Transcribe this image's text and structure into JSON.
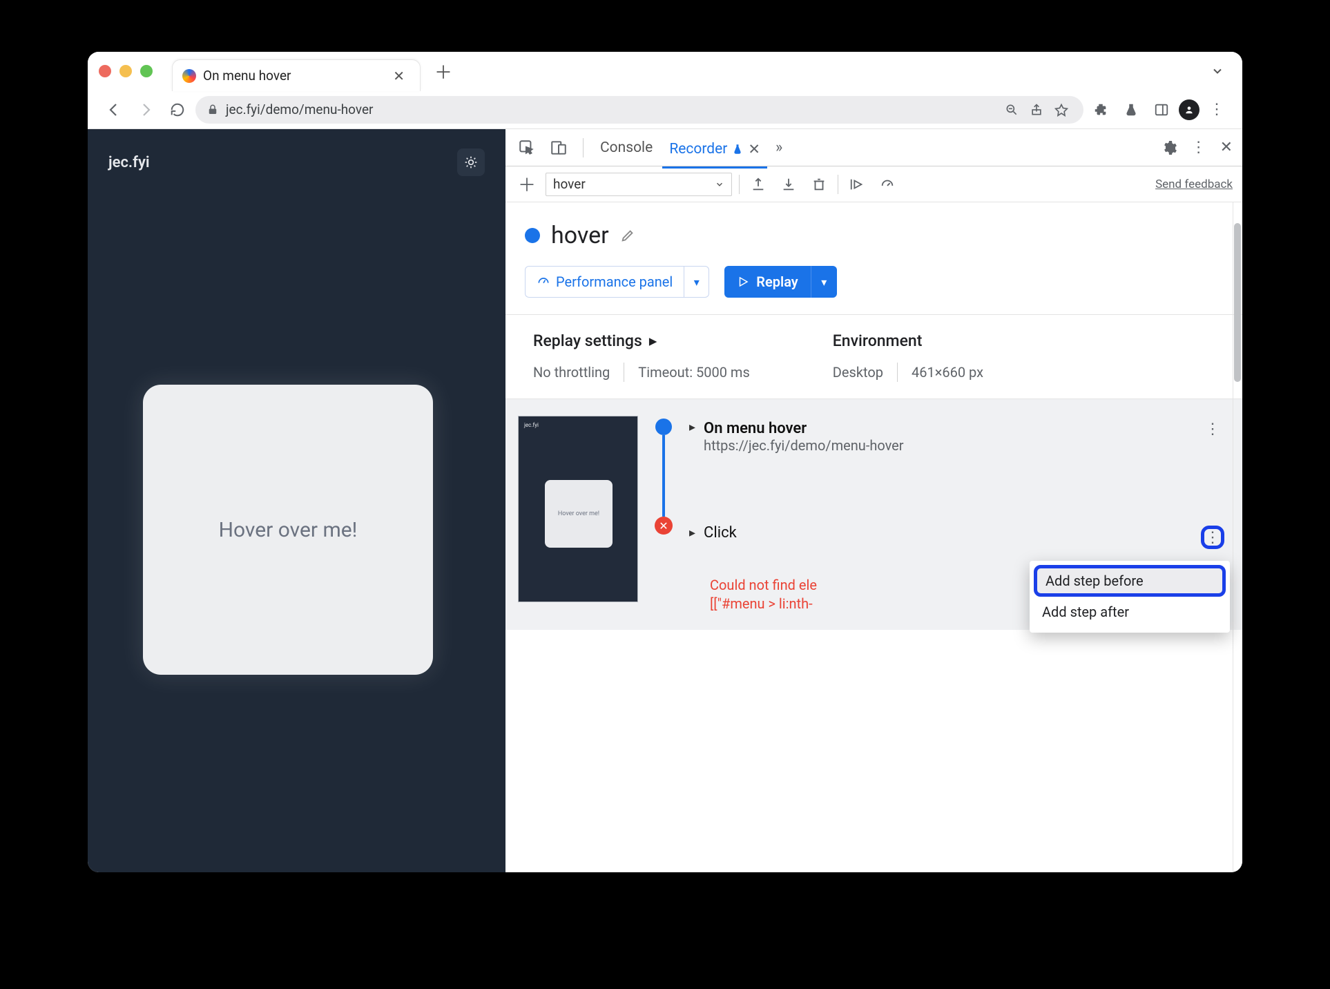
{
  "browser": {
    "traffic_colors": [
      "#ed6a5e",
      "#f5bf4f",
      "#61c454"
    ],
    "tab_title": "On menu hover",
    "url_display": "jec.fyi/demo/menu-hover"
  },
  "page": {
    "brand": "jec.fyi",
    "hero_text": "Hover over me!"
  },
  "devtools": {
    "tabs": {
      "console": "Console",
      "recorder": "Recorder"
    },
    "recorder": {
      "dropdown_value": "hover",
      "feedback": "Send feedback",
      "title": "hover",
      "perf_panel": "Performance panel",
      "replay": "Replay",
      "settings": {
        "replay_heading": "Replay settings",
        "throttling": "No throttling",
        "timeout": "Timeout: 5000 ms",
        "env_heading": "Environment",
        "env_device": "Desktop",
        "env_size": "461×660 px"
      },
      "thumb_text": "Hover over me!",
      "steps": {
        "step1_title": "On menu hover",
        "step1_url": "https://jec.fyi/demo/menu-hover",
        "step2_title": "Click",
        "error_line1": "Could not find ele",
        "error_line2": "[[\"#menu > li:nth-"
      },
      "menu": {
        "before": "Add step before",
        "after": "Add step after"
      }
    }
  }
}
